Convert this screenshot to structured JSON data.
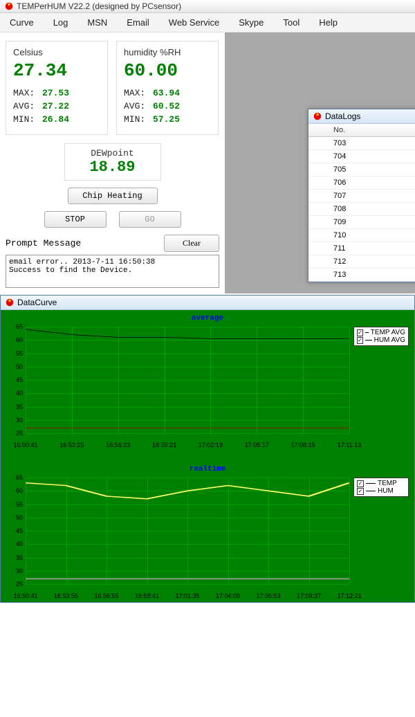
{
  "title": "TEMPerHUM V22.2 (designed by PCsensor)",
  "menu": [
    "Curve",
    "Log",
    "MSN",
    "Email",
    "Web Service",
    "Skype",
    "Tool",
    "Help"
  ],
  "readings": {
    "celsius": {
      "label": "Celsius",
      "value": "27.34",
      "max_label": "MAX:",
      "max": "27.53",
      "avg_label": "AVG:",
      "avg": "27.22",
      "min_label": "MIN:",
      "min": "26.84"
    },
    "humidity": {
      "label": "humidity %RH",
      "value": "60.00",
      "max_label": "MAX:",
      "max": "63.94",
      "avg_label": "AVG:",
      "avg": "60.52",
      "min_label": "MIN:",
      "min": "57.25"
    },
    "dew": {
      "label": "DEWpoint",
      "value": "18.89"
    }
  },
  "buttons": {
    "chip": "Chip Heating",
    "stop": "STOP",
    "go": "GO",
    "clear": "Clear"
  },
  "prompt": {
    "label": "Prompt Message",
    "msg1": "email error.. 2013-7-11 16:50:38",
    "msg2": "Success to find the Device."
  },
  "datalogs": {
    "title": "DataLogs",
    "col_no": "No.",
    "rows": [
      "703",
      "704",
      "705",
      "706",
      "707",
      "708",
      "709",
      "710",
      "711",
      "712",
      "713"
    ]
  },
  "datacurve": {
    "title": "DataCurve"
  },
  "chart_data": [
    {
      "type": "line",
      "title": "average",
      "ylim": [
        25,
        65
      ],
      "yticks": [
        25,
        30,
        35,
        40,
        45,
        50,
        55,
        60,
        65
      ],
      "xticks": [
        "16:50:41",
        "16:53:25",
        "16:56:23",
        "16:59:21",
        "17:02:19",
        "17:05:17",
        "17:08:15",
        "17:11:13"
      ],
      "legend": [
        "TEMP AVG",
        "HUM AVG"
      ],
      "series": [
        {
          "name": "TEMP AVG",
          "values": [
            27,
            27,
            27,
            27,
            27,
            27,
            27,
            27
          ]
        },
        {
          "name": "HUM AVG",
          "values": [
            64,
            62,
            61,
            61,
            60.5,
            60.5,
            60.5,
            60.5
          ]
        }
      ]
    },
    {
      "type": "line",
      "title": "realtime",
      "ylim": [
        25,
        65
      ],
      "yticks": [
        25,
        30,
        35,
        40,
        45,
        50,
        55,
        60,
        65
      ],
      "xticks": [
        "16:50:41",
        "16:53:55",
        "16:56:55",
        "16:58:41",
        "17:01:35",
        "17:04:09",
        "17:06:53",
        "17:09:37",
        "17:12:21"
      ],
      "legend": [
        "TEMP",
        "HUM"
      ],
      "series": [
        {
          "name": "TEMP",
          "values": [
            27,
            27,
            27,
            27,
            27,
            27,
            27,
            27,
            27
          ]
        },
        {
          "name": "HUM",
          "values": [
            63,
            62,
            58,
            57,
            60,
            62,
            60,
            58,
            63
          ]
        }
      ]
    }
  ]
}
